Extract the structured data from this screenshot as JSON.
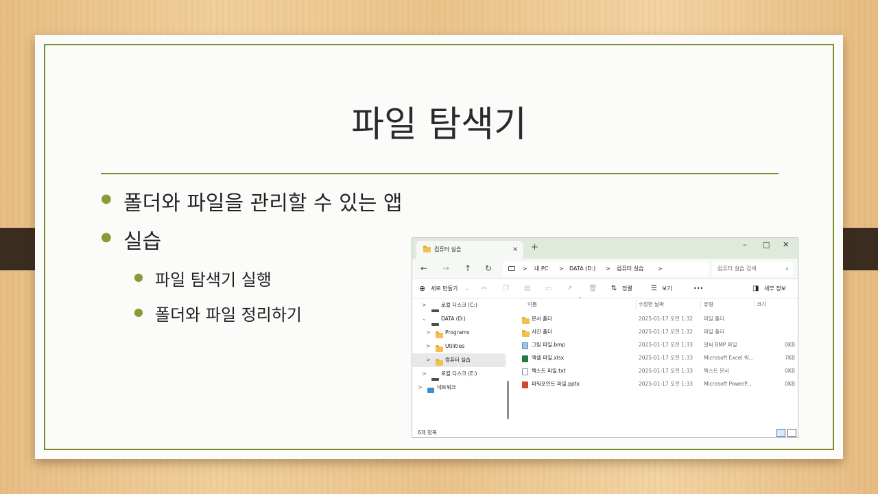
{
  "slide": {
    "title": "파일 탐색기",
    "bullets": [
      {
        "text": "폴더와 파일을 관리할 수 있는 앱"
      },
      {
        "text": "실습",
        "sub": [
          "파일 탐색기 실행",
          "폴더와 파일 정리하기"
        ]
      }
    ],
    "accent_color": "#7c8c2c"
  },
  "explorer": {
    "tab_title": "컴퓨터 실습",
    "tab_close": "×",
    "new_tab": "+",
    "window_controls": {
      "minimize": "–",
      "maximize": "□",
      "close": "✕"
    },
    "nav": {
      "back": "←",
      "forward": "→",
      "up": "↑",
      "refresh": "↻"
    },
    "breadcrumb": [
      "내 PC",
      "DATA (D:)",
      "컴퓨터 실습"
    ],
    "breadcrumb_sep": ">",
    "search_placeholder": "컴퓨터 실습 검색",
    "toolbar": {
      "new_label": "새로 만들기",
      "sort_label": "정렬",
      "view_label": "보기",
      "more_label": "•••",
      "details_label": "세부 정보"
    },
    "sidebar": [
      {
        "label": "로컬 디스크 (C:)",
        "chevron": ">"
      },
      {
        "label": "DATA (D:)",
        "chevron": "⌄"
      },
      {
        "label": "Programs",
        "chevron": ">"
      },
      {
        "label": "Utilities",
        "chevron": ">"
      },
      {
        "label": "컴퓨터 실습",
        "chevron": ">"
      },
      {
        "label": "로컬 디스크 (E:)",
        "chevron": ">"
      },
      {
        "label": "네트워크",
        "chevron": ">"
      }
    ],
    "columns": {
      "name": "이름",
      "date": "수정한 날짜",
      "type": "유형",
      "size": "크기"
    },
    "files": [
      {
        "name": "문서 폴더",
        "date": "2025-01-17 오전 1:32",
        "type": "파일 폴더",
        "size": ""
      },
      {
        "name": "사진 폴더",
        "date": "2025-01-17 오전 1:32",
        "type": "파일 폴더",
        "size": ""
      },
      {
        "name": "그림 파일.bmp",
        "date": "2025-01-17 오전 1:33",
        "type": "알씨 BMP 파일",
        "size": "0KB"
      },
      {
        "name": "엑셀 파일.xlsx",
        "date": "2025-01-17 오전 1:33",
        "type": "Microsoft Excel 워...",
        "size": "7KB"
      },
      {
        "name": "텍스트 파일.txt",
        "date": "2025-01-17 오전 1:33",
        "type": "텍스트 문서",
        "size": "0KB"
      },
      {
        "name": "파워포인트 파일.pptx",
        "date": "2025-01-17 오전 1:33",
        "type": "Microsoft PowerP...",
        "size": "0KB"
      }
    ],
    "status_count": "6개 항목"
  }
}
